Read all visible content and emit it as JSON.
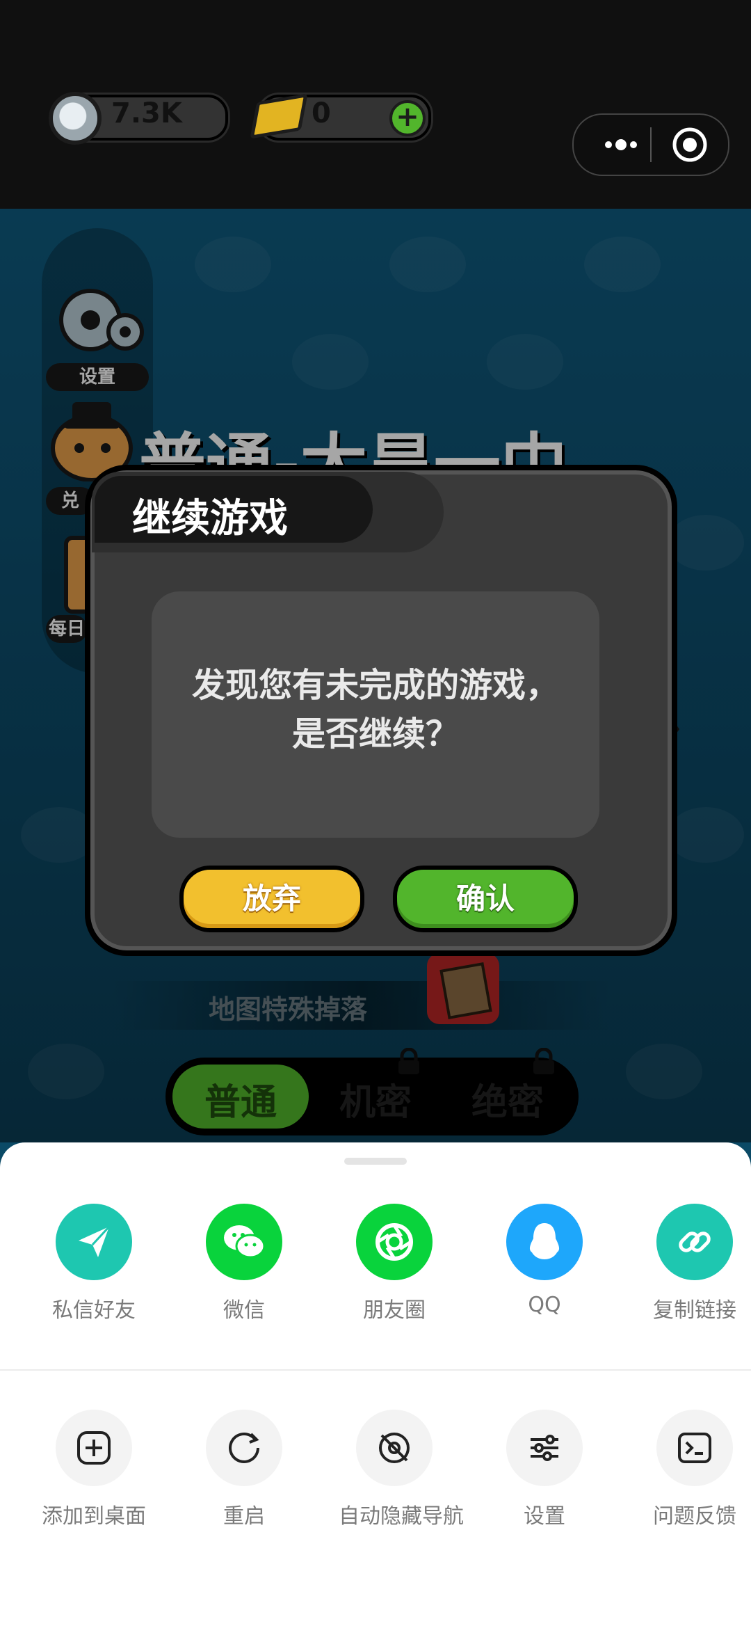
{
  "top_bar": {
    "coins_value": "7.3K",
    "gold_value": "0",
    "menu_icon": "more-dots-icon",
    "close_icon": "target-circle-icon"
  },
  "sidebar": {
    "settings_label": "设置",
    "item2_label": "兑",
    "item3_label": "每日"
  },
  "game": {
    "level_title": "普通-太昊一中",
    "special_drop_label": "地图特殊掉落",
    "mode_tabs": [
      "普通",
      "机密",
      "绝密"
    ]
  },
  "dialog": {
    "title": "继续游戏",
    "message": "发现您有未完成的游戏，是否继续？",
    "abandon_label": "放弃",
    "confirm_label": "确认"
  },
  "share_row": [
    {
      "label": "私信好友",
      "icon": "paper-plane-icon",
      "color": "#1ec7b0"
    },
    {
      "label": "微信",
      "icon": "wechat-icon",
      "color": "#09d33c"
    },
    {
      "label": "朋友圈",
      "icon": "moments-aperture-icon",
      "color": "#09d33c"
    },
    {
      "label": "QQ",
      "icon": "qq-penguin-icon",
      "color": "#1ea7fb"
    },
    {
      "label": "复制链接",
      "icon": "link-icon",
      "color": "#1ec7b0"
    }
  ],
  "tool_row": [
    {
      "label": "添加到桌面",
      "icon": "add-square-icon"
    },
    {
      "label": "重启",
      "icon": "restart-icon"
    },
    {
      "label": "自动隐藏导航",
      "icon": "hide-nav-icon"
    },
    {
      "label": "设置",
      "icon": "sliders-icon"
    },
    {
      "label": "问题反馈",
      "icon": "terminal-feedback-icon"
    }
  ]
}
